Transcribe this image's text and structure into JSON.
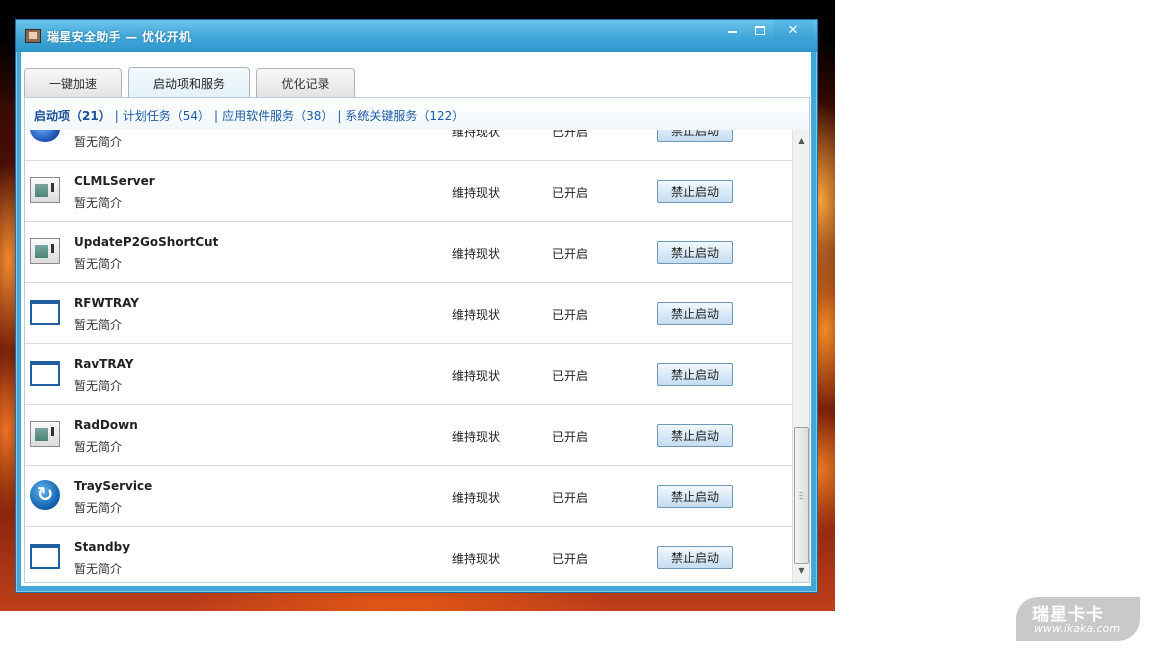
{
  "window": {
    "title": "瑞星安全助手 — 优化开机",
    "controls": {
      "minimize_icon": "minimize-icon",
      "maximize_icon": "maximize-icon",
      "close_icon": "close-icon"
    }
  },
  "tabs": [
    {
      "label": "一键加速",
      "active": false
    },
    {
      "label": "启动项和服务",
      "active": true
    },
    {
      "label": "优化记录",
      "active": false
    }
  ],
  "subnav": [
    {
      "label": "启动项（21）",
      "active": true
    },
    {
      "label": "计划任务（54）",
      "active": false
    },
    {
      "label": "应用软件服务（38）",
      "active": false
    },
    {
      "label": "系统关键服务（122）",
      "active": false
    }
  ],
  "subnav_separator": "|",
  "rows": [
    {
      "icon": "globe-icon",
      "name": "",
      "desc": "暂无简介",
      "action": "维持现状",
      "state": "已开启",
      "button": "禁止启动"
    },
    {
      "icon": "document-icon",
      "name": "CLMLServer",
      "desc": "暂无简介",
      "action": "维持现状",
      "state": "已开启",
      "button": "禁止启动"
    },
    {
      "icon": "document-icon",
      "name": "UpdateP2GoShortCut",
      "desc": "暂无简介",
      "action": "维持现状",
      "state": "已开启",
      "button": "禁止启动"
    },
    {
      "icon": "window-icon",
      "name": "RFWTRAY",
      "desc": "暂无简介",
      "action": "维持现状",
      "state": "已开启",
      "button": "禁止启动"
    },
    {
      "icon": "window-icon",
      "name": "RavTRAY",
      "desc": "暂无简介",
      "action": "维持现状",
      "state": "已开启",
      "button": "禁止启动"
    },
    {
      "icon": "document-icon",
      "name": "RadDown",
      "desc": "暂无简介",
      "action": "维持现状",
      "state": "已开启",
      "button": "禁止启动"
    },
    {
      "icon": "sync-icon",
      "name": "TrayService",
      "desc": "暂无简介",
      "action": "维持现状",
      "state": "已开启",
      "button": "禁止启动"
    },
    {
      "icon": "window-icon",
      "name": "Standby",
      "desc": "暂无简介",
      "action": "维持现状",
      "state": "已开启",
      "button": "禁止启动"
    }
  ],
  "scrollbar": {
    "position_fraction": 0.92
  },
  "watermark": {
    "brand": "瑞星卡卡",
    "url": "www.ikaka.com"
  },
  "colors": {
    "titlebar": "#3fa6d8",
    "link": "#1b5ca8",
    "button_border": "#6f97b8"
  }
}
